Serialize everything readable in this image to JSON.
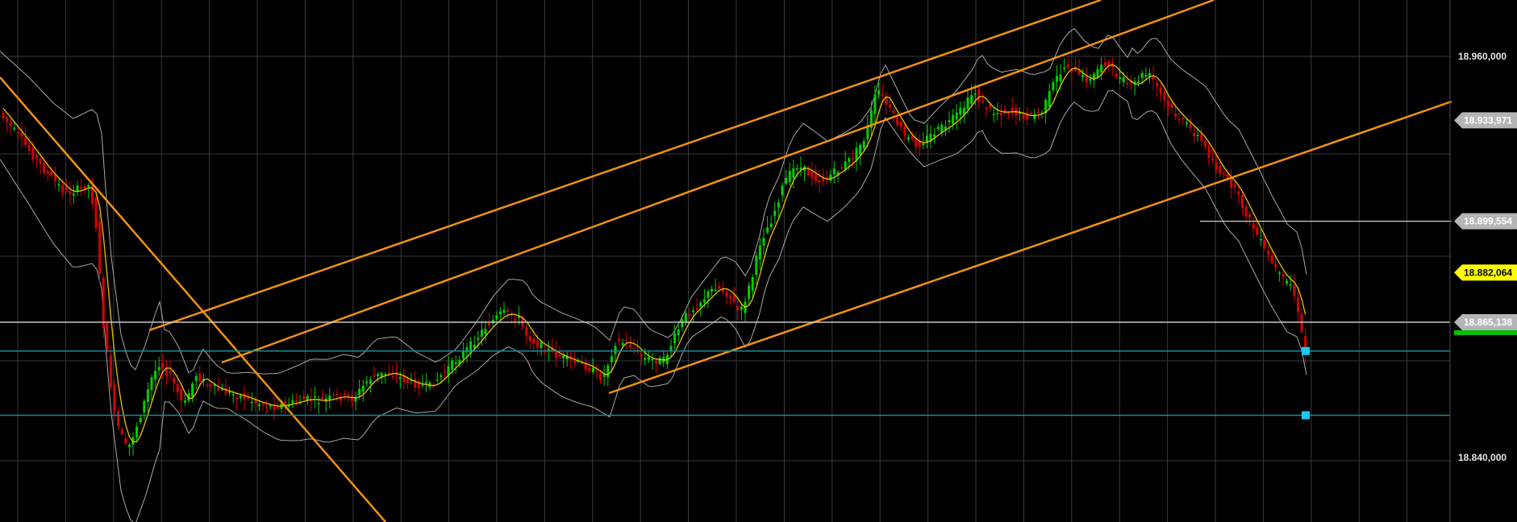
{
  "chart_data": {
    "type": "candlestick",
    "price_axis": {
      "position": "right",
      "ticks": [
        {
          "value": 18960.0,
          "label": "18.960,000"
        },
        {
          "value": 18840.0,
          "label": "18.840,000"
        }
      ]
    },
    "ylim": [
      18797,
      18975
    ],
    "grid": true,
    "price_tags": [
      {
        "value": 18933.971,
        "label": "18.933,971",
        "fill": "#b5b5b5",
        "text_color": "#ffffff"
      },
      {
        "value": 18899.554,
        "label": "18.899,554",
        "fill": "#b5b5b5",
        "text_color": "#ffffff"
      },
      {
        "value": 18882.064,
        "label": "18.882,064",
        "fill": "#ffff00",
        "text_color": "#000000"
      },
      {
        "value": 18865.138,
        "label": "18.865,138",
        "fill": "#b5b5b5",
        "text_color": "#ffffff"
      }
    ],
    "horizontal_lines": [
      {
        "value": 18865.138,
        "color": "#c8c8c8"
      },
      {
        "value": 18855.3,
        "color": "#1a8a9a"
      },
      {
        "value": 18833.4,
        "color": "#1a8a9a"
      }
    ],
    "colors": {
      "background": "#000000",
      "up": "#00d000",
      "down": "#d80000",
      "fast_ma": "#e6c200",
      "bands": "#a8a8a8",
      "trendlines": "#f2920f",
      "grid": "#3a3a3a",
      "marker": "#1ec8f0"
    }
  }
}
